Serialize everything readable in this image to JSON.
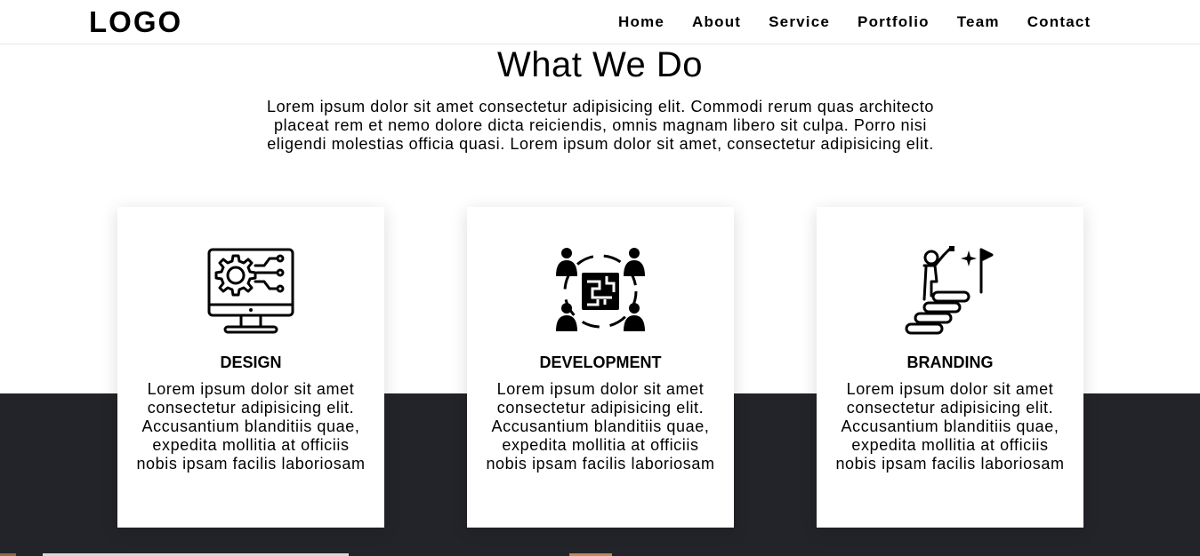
{
  "navbar": {
    "logo": "LOGO",
    "links": [
      "Home",
      "About",
      "Service",
      "Portfolio",
      "Team",
      "Contact"
    ]
  },
  "section": {
    "title": "What We Do",
    "intro": "Lorem ipsum dolor sit amet consectetur adipisicing elit. Commodi rerum quas architecto placeat rem et nemo dolore dicta reiciendis, omnis magnam libero sit culpa. Porro nisi eligendi molestias officia quasi. Lorem ipsum dolor sit amet, consectetur adipisicing elit."
  },
  "cards": [
    {
      "icon": "computer-gear-icon",
      "title": "DESIGN",
      "text": "Lorem ipsum dolor sit amet consectetur adipisicing elit. Accusantium blanditiis quae, expedita mollitia at officiis nobis ipsam facilis laboriosam"
    },
    {
      "icon": "team-collaboration-icon",
      "title": "DEVELOPMENT",
      "text": "Lorem ipsum dolor sit amet consectetur adipisicing elit. Accusantium blanditiis quae, expedita mollitia at officiis nobis ipsam facilis laboriosam"
    },
    {
      "icon": "success-stairs-icon",
      "title": "BRANDING",
      "text": "Lorem ipsum dolor sit amet consectetur adipisicing elit. Accusantium blanditiis quae, expedita mollitia at officiis nobis ipsam facilis laboriosam"
    }
  ],
  "colors": {
    "dark_band": "#232429",
    "text": "#000000",
    "card_background": "#ffffff"
  }
}
